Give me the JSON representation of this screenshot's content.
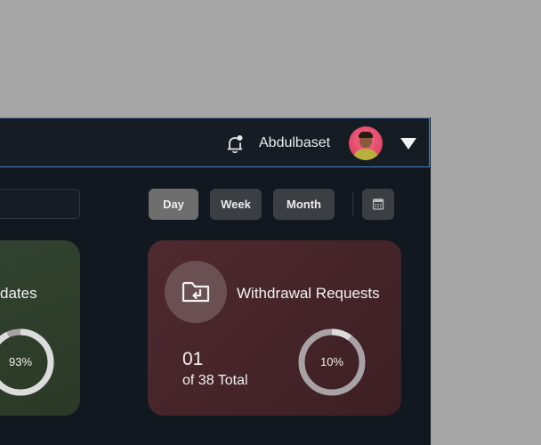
{
  "header": {
    "username": "Abdulbaset",
    "avatar_icon": "user-avatar-icon",
    "notification_icon": "bell-icon",
    "menu_icon": "caret-down-icon"
  },
  "filters": {
    "search_value": "",
    "periods": [
      "Day",
      "Week",
      "Month"
    ],
    "selected_period": "Day",
    "calendar_icon": "calendar-icon"
  },
  "cards": [
    {
      "title": "dates",
      "percent_label": "93%",
      "percent": 93,
      "color": "#324230"
    },
    {
      "title": "Withdrawal Requests",
      "icon": "folder-return-icon",
      "count": "01",
      "total_label": "of 38 Total",
      "percent_label": "10%",
      "percent": 10,
      "color": "#4f2a2f"
    }
  ],
  "colors": {
    "accent_border": "#4a84c4",
    "ring_track": "#a9a2a4",
    "ring_fill": "#d9d9d9"
  }
}
